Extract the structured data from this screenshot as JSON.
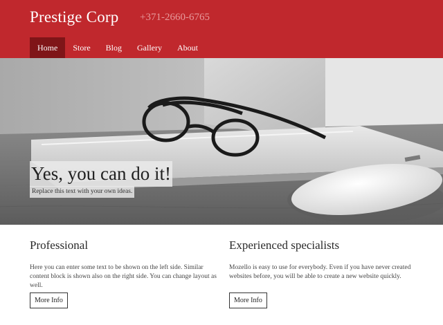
{
  "header": {
    "brand": "Prestige Corp",
    "phone": "+371-2660-6765",
    "nav": [
      {
        "label": "Home",
        "active": true
      },
      {
        "label": "Store"
      },
      {
        "label": "Blog"
      },
      {
        "label": "Gallery"
      },
      {
        "label": "About"
      }
    ]
  },
  "hero": {
    "title": "Yes, you can do it!",
    "subtitle": "Replace this text with your own ideas."
  },
  "columns": [
    {
      "heading": "Professional",
      "text": "Here you can enter some text to be shown on the left side. Similar content block is shown also on the right side. You can change layout as well.",
      "button": "More Info"
    },
    {
      "heading": "Experienced specialists",
      "text": "Mozello is easy to use for everybody. Even if you have never created websites before, you will be able to create a new website quickly.",
      "button": "More Info"
    }
  ],
  "colors": {
    "header_bg": "#c0282d",
    "nav_active_bg": "#7f1518",
    "phone_text": "#e79a9c"
  }
}
